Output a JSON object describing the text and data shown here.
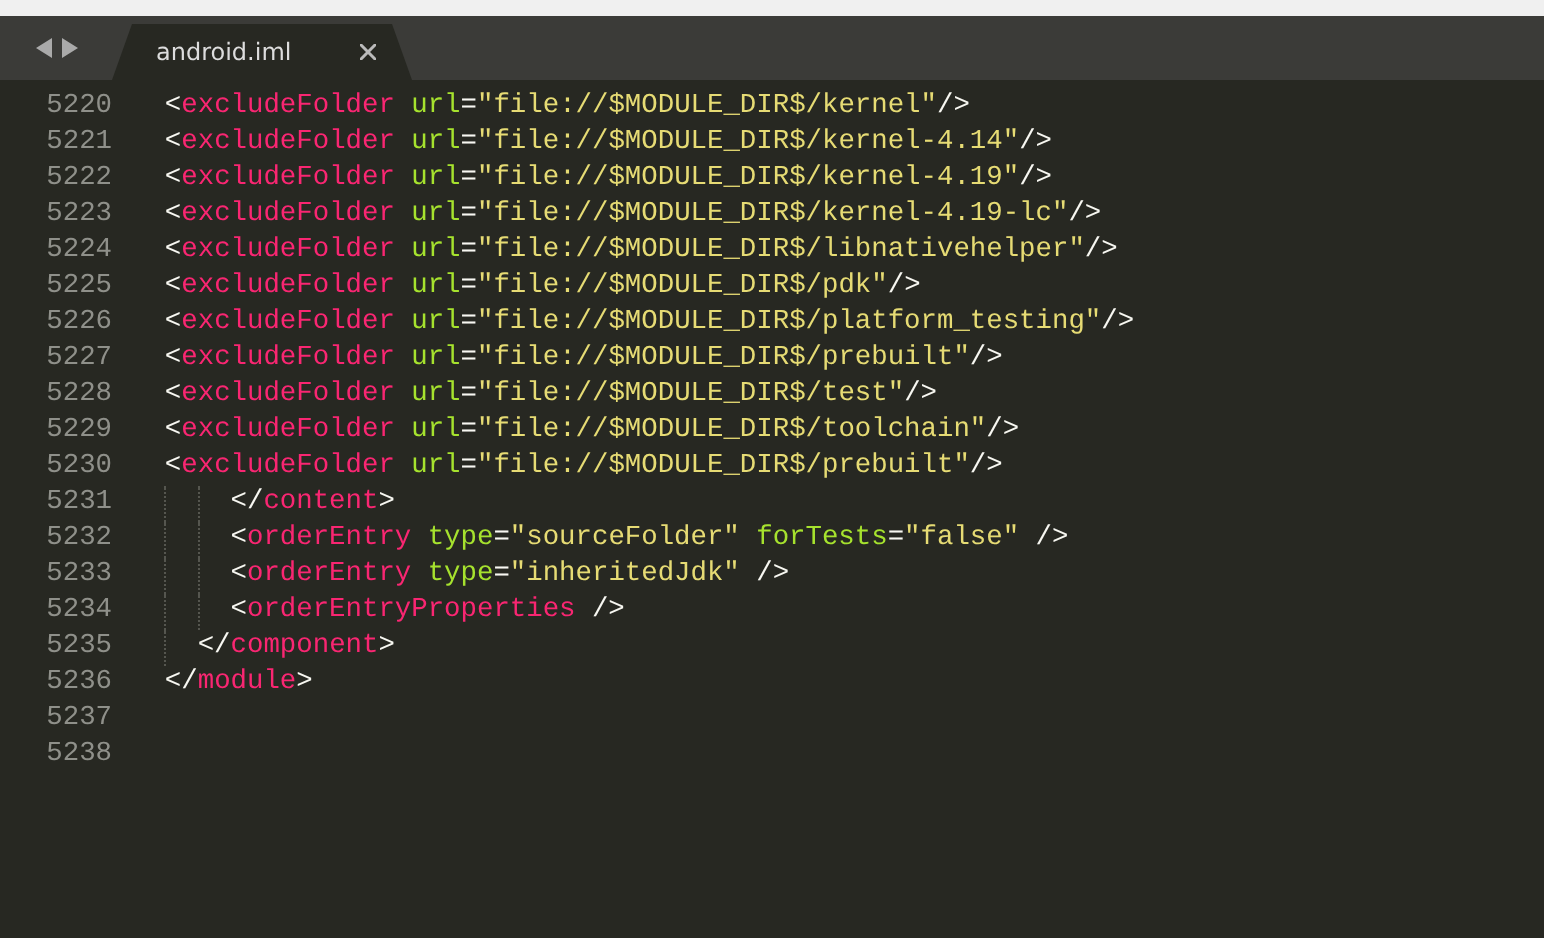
{
  "tab_bar": {
    "tabs": [
      {
        "label": "android.iml",
        "selected": true
      }
    ]
  },
  "editor": {
    "lines": [
      {
        "number": "5220",
        "kind": "outer",
        "tokens": [
          {
            "kind": "punct",
            "text": "<"
          },
          {
            "kind": "tag",
            "text": "excludeFolder"
          },
          {
            "kind": "attr",
            "text": "url",
            "spaced": true
          },
          {
            "kind": "punct",
            "text": "="
          },
          {
            "kind": "string",
            "text": "\"file://$MODULE_DIR$/kernel\""
          },
          {
            "kind": "punct",
            "text": "/>"
          }
        ]
      },
      {
        "number": "5221",
        "kind": "outer",
        "tokens": [
          {
            "kind": "punct",
            "text": "<"
          },
          {
            "kind": "tag",
            "text": "excludeFolder"
          },
          {
            "kind": "attr",
            "text": "url",
            "spaced": true
          },
          {
            "kind": "punct",
            "text": "="
          },
          {
            "kind": "string",
            "text": "\"file://$MODULE_DIR$/kernel-4.14\""
          },
          {
            "kind": "punct",
            "text": "/>"
          }
        ]
      },
      {
        "number": "5222",
        "kind": "outer",
        "tokens": [
          {
            "kind": "punct",
            "text": "<"
          },
          {
            "kind": "tag",
            "text": "excludeFolder"
          },
          {
            "kind": "attr",
            "text": "url",
            "spaced": true
          },
          {
            "kind": "punct",
            "text": "="
          },
          {
            "kind": "string",
            "text": "\"file://$MODULE_DIR$/kernel-4.19\""
          },
          {
            "kind": "punct",
            "text": "/>"
          }
        ]
      },
      {
        "number": "5223",
        "kind": "outer",
        "tokens": [
          {
            "kind": "punct",
            "text": "<"
          },
          {
            "kind": "tag",
            "text": "excludeFolder"
          },
          {
            "kind": "attr",
            "text": "url",
            "spaced": true
          },
          {
            "kind": "punct",
            "text": "="
          },
          {
            "kind": "string",
            "text": "\"file://$MODULE_DIR$/kernel-4.19-lc\""
          },
          {
            "kind": "punct",
            "text": "/>"
          }
        ]
      },
      {
        "number": "5224",
        "kind": "outer",
        "tokens": [
          {
            "kind": "punct",
            "text": "<"
          },
          {
            "kind": "tag",
            "text": "excludeFolder"
          },
          {
            "kind": "attr",
            "text": "url",
            "spaced": true
          },
          {
            "kind": "punct",
            "text": "="
          },
          {
            "kind": "string",
            "text": "\"file://$MODULE_DIR$/libnativehelper\""
          },
          {
            "kind": "punct",
            "text": "/>"
          }
        ]
      },
      {
        "number": "5225",
        "kind": "outer",
        "tokens": [
          {
            "kind": "punct",
            "text": "<"
          },
          {
            "kind": "tag",
            "text": "excludeFolder"
          },
          {
            "kind": "attr",
            "text": "url",
            "spaced": true
          },
          {
            "kind": "punct",
            "text": "="
          },
          {
            "kind": "string",
            "text": "\"file://$MODULE_DIR$/pdk\""
          },
          {
            "kind": "punct",
            "text": "/>"
          }
        ]
      },
      {
        "number": "5226",
        "kind": "outer",
        "tokens": [
          {
            "kind": "punct",
            "text": "<"
          },
          {
            "kind": "tag",
            "text": "excludeFolder"
          },
          {
            "kind": "attr",
            "text": "url",
            "spaced": true
          },
          {
            "kind": "punct",
            "text": "="
          },
          {
            "kind": "string",
            "text": "\"file://$MODULE_DIR$/platform_testing\""
          },
          {
            "kind": "punct",
            "text": "/>"
          }
        ]
      },
      {
        "number": "5227",
        "kind": "outer",
        "tokens": [
          {
            "kind": "punct",
            "text": "<"
          },
          {
            "kind": "tag",
            "text": "excludeFolder"
          },
          {
            "kind": "attr",
            "text": "url",
            "spaced": true
          },
          {
            "kind": "punct",
            "text": "="
          },
          {
            "kind": "string",
            "text": "\"file://$MODULE_DIR$/prebuilt\""
          },
          {
            "kind": "punct",
            "text": "/>"
          }
        ]
      },
      {
        "number": "5228",
        "kind": "outer",
        "tokens": [
          {
            "kind": "punct",
            "text": "<"
          },
          {
            "kind": "tag",
            "text": "excludeFolder"
          },
          {
            "kind": "attr",
            "text": "url",
            "spaced": true
          },
          {
            "kind": "punct",
            "text": "="
          },
          {
            "kind": "string",
            "text": "\"file://$MODULE_DIR$/test\""
          },
          {
            "kind": "punct",
            "text": "/>"
          }
        ]
      },
      {
        "number": "5229",
        "kind": "outer",
        "tokens": [
          {
            "kind": "punct",
            "text": "<"
          },
          {
            "kind": "tag",
            "text": "excludeFolder"
          },
          {
            "kind": "attr",
            "text": "url",
            "spaced": true
          },
          {
            "kind": "punct",
            "text": "="
          },
          {
            "kind": "string",
            "text": "\"file://$MODULE_DIR$/toolchain\""
          },
          {
            "kind": "punct",
            "text": "/>"
          }
        ]
      },
      {
        "number": "5230",
        "kind": "outer",
        "tokens": [
          {
            "kind": "punct",
            "text": "<"
          },
          {
            "kind": "tag",
            "text": "excludeFolder"
          },
          {
            "kind": "attr",
            "text": "url",
            "spaced": true
          },
          {
            "kind": "punct",
            "text": "="
          },
          {
            "kind": "string",
            "text": "\"file://$MODULE_DIR$/prebuilt\""
          },
          {
            "kind": "punct",
            "text": "/>"
          }
        ]
      },
      {
        "number": "5231",
        "kind": "inner",
        "tokens": [
          {
            "kind": "punct",
            "text": "</"
          },
          {
            "kind": "tag",
            "text": "content"
          },
          {
            "kind": "punct",
            "text": ">"
          }
        ]
      },
      {
        "number": "5232",
        "kind": "inner",
        "tokens": [
          {
            "kind": "punct",
            "text": "<"
          },
          {
            "kind": "tag",
            "text": "orderEntry"
          },
          {
            "kind": "attr",
            "text": "type",
            "spaced": true
          },
          {
            "kind": "punct",
            "text": "="
          },
          {
            "kind": "string",
            "text": "\"sourceFolder\""
          },
          {
            "kind": "attr",
            "text": "forTests",
            "spaced": true
          },
          {
            "kind": "punct",
            "text": "="
          },
          {
            "kind": "string",
            "text": "\"false\""
          },
          {
            "kind": "punct",
            "text": "/>",
            "spaced": true
          }
        ]
      },
      {
        "number": "5233",
        "kind": "inner",
        "tokens": [
          {
            "kind": "punct",
            "text": "<"
          },
          {
            "kind": "tag",
            "text": "orderEntry"
          },
          {
            "kind": "attr",
            "text": "type",
            "spaced": true
          },
          {
            "kind": "punct",
            "text": "="
          },
          {
            "kind": "string",
            "text": "\"inheritedJdk\""
          },
          {
            "kind": "punct",
            "text": "/>",
            "spaced": true
          }
        ]
      },
      {
        "number": "5234",
        "kind": "inner",
        "tokens": [
          {
            "kind": "punct",
            "text": "<"
          },
          {
            "kind": "tag",
            "text": "orderEntryProperties"
          },
          {
            "kind": "punct",
            "text": "/>",
            "spaced": true
          }
        ]
      },
      {
        "number": "5235",
        "kind": "middle",
        "tokens": [
          {
            "kind": "punct",
            "text": "</"
          },
          {
            "kind": "tag",
            "text": "component"
          },
          {
            "kind": "punct",
            "text": ">"
          }
        ]
      },
      {
        "number": "5236",
        "kind": "outer",
        "tokens": [
          {
            "kind": "punct",
            "text": "</"
          },
          {
            "kind": "tag",
            "text": "module"
          },
          {
            "kind": "punct",
            "text": ">"
          }
        ]
      },
      {
        "number": "5237",
        "kind": "empty"
      },
      {
        "number": "5238",
        "kind": "empty"
      }
    ]
  }
}
